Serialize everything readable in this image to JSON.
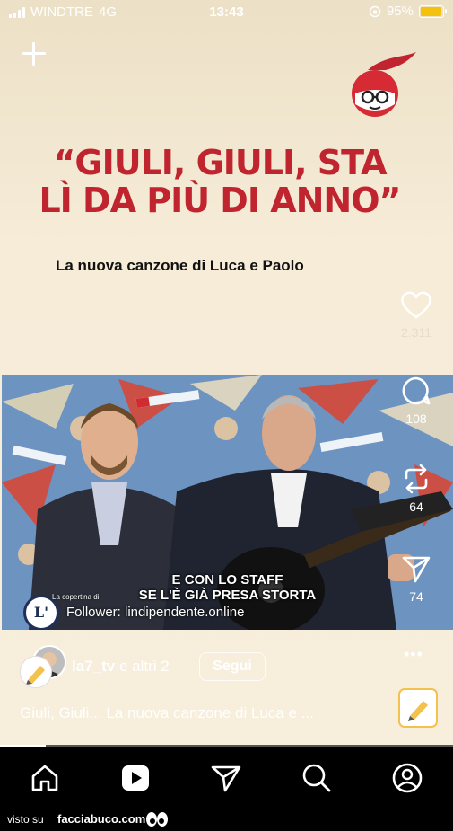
{
  "status_bar": {
    "carrier": "WINDTRE",
    "network": "4G",
    "time": "13:43",
    "battery": "95%",
    "battery_color": "#f4c20d"
  },
  "post": {
    "headline_line1": "“GIULI, GIULI, STA",
    "headline_line2": "LÌ DA PIÙ DI ANNO”",
    "subtitle": "La nuova canzone di Luca e Paolo",
    "headline_color": "#c0242f"
  },
  "video": {
    "caption_line1": "E CON LO STAFF",
    "caption_line2": "SE L'È GIÀ PRESA STORTA",
    "follower_text": "Follower: lindipendente.online",
    "logo_letter": "L'",
    "small_text": "La copertina di"
  },
  "actions": {
    "likes": "2.311",
    "comments": "108",
    "reposts": "64",
    "shares": "74"
  },
  "author": {
    "username": "la7_tv",
    "others": "e altri 2",
    "follow_label": "Segui",
    "description": "Giuli, Giuli... La nuova canzone di Luca e ...",
    "more": "•••"
  },
  "progress_fraction": 0.1,
  "tab_bar": [
    "home-icon",
    "reels-icon",
    "send-icon",
    "search-icon",
    "profile-icon"
  ],
  "watermark": {
    "prefix": "visto su",
    "site": "facciabuco.com"
  }
}
